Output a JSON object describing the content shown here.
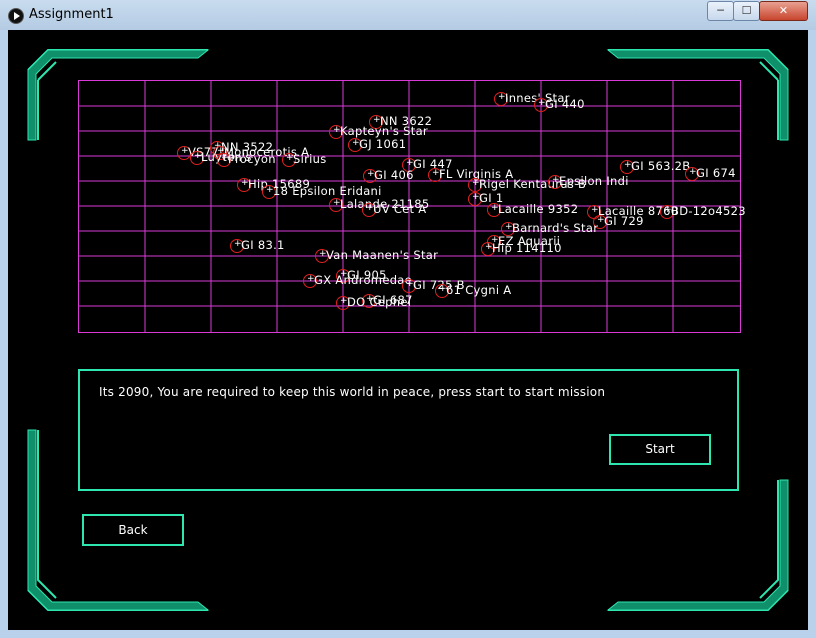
{
  "window": {
    "title": "Assignment1",
    "controls": {
      "minimize": "─",
      "maximize": "☐",
      "close": "✕"
    }
  },
  "colors": {
    "accent": "#2ee6b0",
    "grid": "#d93ad6",
    "star_ring": "#e02020",
    "text": "#ffffff",
    "background": "#000000"
  },
  "stars": [
    {
      "name": "Innes' Star"
    },
    {
      "name": "GI 440"
    },
    {
      "name": "NN 3622"
    },
    {
      "name": "Kapteyn's Star"
    },
    {
      "name": "GJ 1061"
    },
    {
      "name": "NN 3522"
    },
    {
      "name": "VS77"
    },
    {
      "name": "Monocerotis A"
    },
    {
      "name": "Luyten's"
    },
    {
      "name": "Procyon"
    },
    {
      "name": "Sirius"
    },
    {
      "name": "GI 447"
    },
    {
      "name": "GI 406"
    },
    {
      "name": "FL Virginis A"
    },
    {
      "name": "GI 563.2B"
    },
    {
      "name": "GI 674"
    },
    {
      "name": "Rigel Kentaurus B"
    },
    {
      "name": "Epsilon Indi"
    },
    {
      "name": "Hip 15689"
    },
    {
      "name": "18 Epsilon Eridani"
    },
    {
      "name": "GI 1"
    },
    {
      "name": "Lalande 21185"
    },
    {
      "name": "UV Cet A"
    },
    {
      "name": "Lacaille 9352"
    },
    {
      "name": "Lacaille 8760"
    },
    {
      "name": "BD-12o4523"
    },
    {
      "name": "GI 729"
    },
    {
      "name": "Barnard's Star"
    },
    {
      "name": "EZ Aquarii"
    },
    {
      "name": "Hip 114110"
    },
    {
      "name": "GI 83.1"
    },
    {
      "name": "Van Maanen's Star"
    },
    {
      "name": "GI 905"
    },
    {
      "name": "GX Andromedae"
    },
    {
      "name": "GI 725 B"
    },
    {
      "name": "61 Cygni A"
    },
    {
      "name": "GI 687"
    },
    {
      "name": "DO Cephei"
    }
  ],
  "message": {
    "text": "Its 2090, You are required to keep this world in peace, press start to start mission",
    "start_label": "Start"
  },
  "back_label": "Back"
}
